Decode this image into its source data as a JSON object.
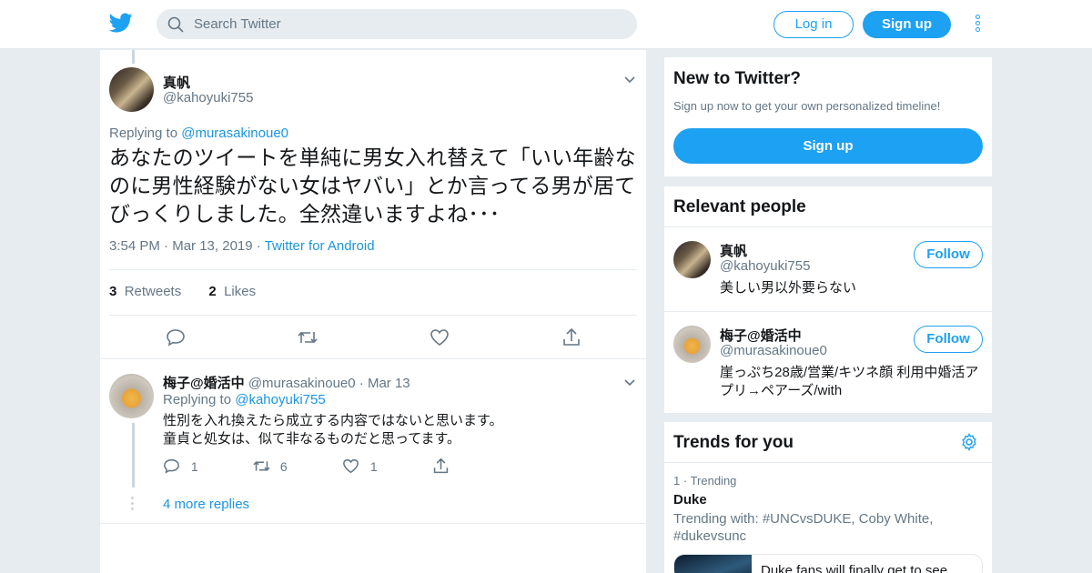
{
  "header": {
    "search_placeholder": "Search Twitter",
    "login": "Log in",
    "signup": "Sign up"
  },
  "tweet": {
    "name": "真帆",
    "handle": "@kahoyuki755",
    "replying_label": "Replying to",
    "replying_handle": "@murasakinoue0",
    "text": "あなたのツイートを単純に男女入れ替えて「いい年齢なのに男性経験がない女はヤバい」とか言ってる男が居てびっくりしました。全然違いますよね･･･",
    "time": "3:54 PM",
    "date": "Mar 13, 2019",
    "source": "Twitter for Android",
    "retweets_count": "3",
    "retweets_label": "Retweets",
    "likes_count": "2",
    "likes_label": "Likes"
  },
  "reply": {
    "name": "梅子@婚活中",
    "handle": "@murasakinoue0",
    "date": "Mar 13",
    "replying_label": "Replying to",
    "replying_handle": "@kahoyuki755",
    "line1": "性別を入れ換えたら成立する内容ではないと思います。",
    "line2": "童貞と処女は、似て非なるものだと思ってます。",
    "replies": "1",
    "retweets": "6",
    "likes": "1"
  },
  "more_replies": "4 more replies",
  "sidebar": {
    "new_title": "New to Twitter?",
    "new_sub": "Sign up now to get your own personalized timeline!",
    "new_signup": "Sign up",
    "relevant_title": "Relevant people",
    "people": [
      {
        "name": "真帆",
        "handle": "@kahoyuki755",
        "bio": "美しい男以外要らない",
        "follow": "Follow"
      },
      {
        "name": "梅子@婚活中",
        "handle": "@murasakinoue0",
        "bio_line1": "崖っぷち28歳/営業/キツネ顔 利用中婚活ア",
        "bio_line2": "プリ→ペアーズ/with",
        "follow": "Follow"
      }
    ],
    "trends_title": "Trends for you",
    "trend": {
      "rank": "1",
      "rank_label": "Trending",
      "name": "Duke",
      "with_line1": "Trending with: #UNCvsDUKE, Coby White,",
      "with_line2": "#dukevsunc",
      "preview": "Duke fans will finally get to see"
    }
  },
  "colors": {
    "accent": "#1da1f2",
    "link": "#1b95e0",
    "muted": "#657786",
    "bg": "#e6ecf0"
  }
}
